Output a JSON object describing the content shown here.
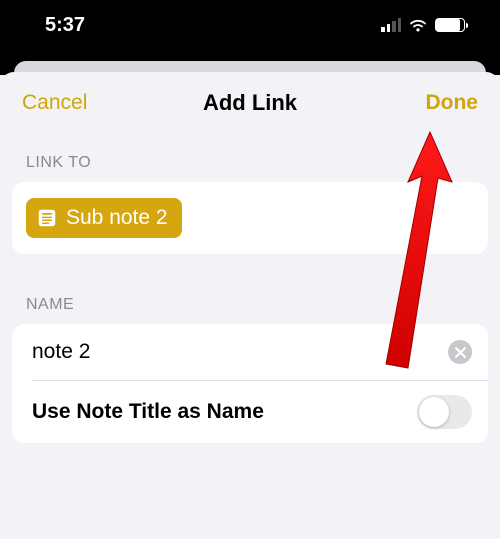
{
  "statusbar": {
    "time": "5:37"
  },
  "sheet": {
    "cancel_label": "Cancel",
    "title": "Add Link",
    "done_label": "Done"
  },
  "link_to": {
    "section_label": "LINK TO",
    "chip_label": "Sub note 2"
  },
  "name": {
    "section_label": "NAME",
    "value": "note 2",
    "toggle_label": "Use Note Title as Name",
    "toggle_on": false
  }
}
